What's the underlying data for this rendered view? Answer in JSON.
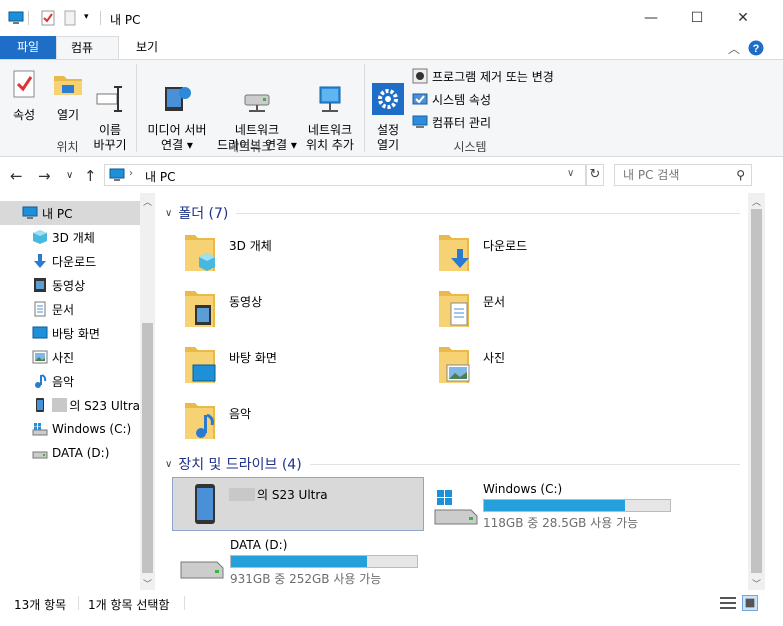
{
  "titlebar": {
    "title": "내 PC"
  },
  "ribbon_tabs": [
    "파일",
    "컴퓨터",
    "보기"
  ],
  "ribbon": {
    "location": {
      "label": "위치",
      "buttons": [
        "속성",
        "열기",
        "이름\n바꾸기"
      ]
    },
    "network": {
      "label": "네트워크",
      "buttons": [
        "미디어 서버\n연결 ▾",
        "네트워크\n드라이브 연결 ▾",
        "네트워크\n위치 추가"
      ]
    },
    "system": {
      "label": "시스템",
      "open_settings": "설정\n열기",
      "items": [
        "프로그램 제거 또는 변경",
        "시스템 속성",
        "컴퓨터 관리"
      ]
    }
  },
  "address": {
    "path": "내 PC",
    "search_placeholder": "내 PC 검색"
  },
  "tree": [
    {
      "label": "내 PC",
      "icon": "pc-icon"
    },
    {
      "label": "3D 개체",
      "icon": "3d-objects-icon"
    },
    {
      "label": "다운로드",
      "icon": "download-icon"
    },
    {
      "label": "동영상",
      "icon": "video-icon"
    },
    {
      "label": "문서",
      "icon": "document-icon"
    },
    {
      "label": "바탕 화면",
      "icon": "desktop-icon"
    },
    {
      "label": "사진",
      "icon": "pictures-icon"
    },
    {
      "label": "음악",
      "icon": "music-icon"
    },
    {
      "label": "의 S23 Ultra",
      "icon": "phone-icon"
    },
    {
      "label": "Windows (C:)",
      "icon": "windows-drive-icon"
    },
    {
      "label": "DATA (D:)",
      "icon": "drive-icon"
    }
  ],
  "sections": {
    "folders": "폴더 (7)",
    "devices": "장치 및 드라이브 (4)"
  },
  "folders": [
    "3D 개체",
    "다운로드",
    "동영상",
    "문서",
    "바탕 화면",
    "사진",
    "음악"
  ],
  "devices": [
    {
      "name": "의 S23 Ultra",
      "size": "",
      "used_fraction": null
    },
    {
      "name": "Windows (C:)",
      "size": "118GB 중 28.5GB 사용 가능",
      "used_fraction": 0.76
    },
    {
      "name": "DATA (D:)",
      "size": "931GB 중 252GB 사용 가능",
      "used_fraction": 0.73
    }
  ],
  "status": {
    "count": "13개 항목",
    "selected": "1개 항목 선택함"
  },
  "colors": {
    "accent": "#1e6ec8",
    "drive_bar": "#26a0da",
    "header_text": "#1e3287"
  }
}
